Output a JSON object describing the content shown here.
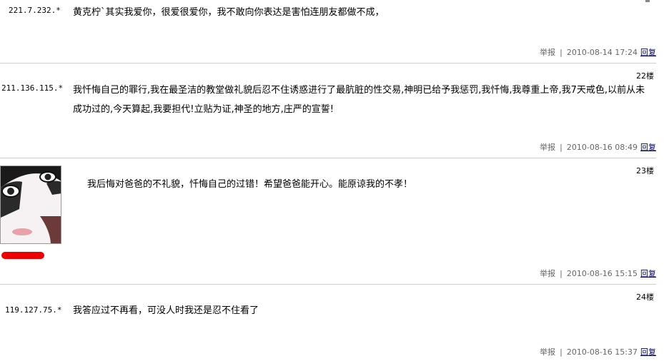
{
  "posts": [
    {
      "ip": "221.7.232.*",
      "floor": "",
      "content": "黄克柠`其实我爱你，很爱很爱你，我不敢向你表达是害怕连朋友都做不成，",
      "report": "举报",
      "date": "2010-08-14 17:24",
      "reply": "回复"
    },
    {
      "ip": "211.136.115.*",
      "floor": "22楼",
      "content": "我忏悔自己的罪行,我在最圣洁的教堂做礼貌后忍不住诱惑进行了最肮脏的性交易,神明已给予我惩罚,我忏悔,我尊重上帝,我7天戒色,以前从未成功过的,今天算起,我要担代!立贴为证,神圣的地方,庄严的宣誓!",
      "report": "举报",
      "date": "2010-08-16 08:49",
      "reply": "回复"
    },
    {
      "ip": "",
      "floor": "23楼",
      "content": "我后悔对爸爸的不礼貌，忏悔自己的过错！希望爸爸能开心。能原谅我的不孝！",
      "report": "举报",
      "date": "2010-08-16 15:15",
      "reply": "回复"
    },
    {
      "ip": "119.127.75.*",
      "floor": "24楼",
      "content": "我答应过不再看，可没人时我还是忍不住看了",
      "report": "举报",
      "date": "2010-08-16 15:37",
      "reply": "回复"
    }
  ],
  "separator": "|",
  "icons": {
    "avatar": "user-avatar-photo",
    "redacted_name": "red-redaction-mark"
  },
  "colors": {
    "redaction": "#ee0000",
    "reply_link": "#000066",
    "meta_text": "#666666",
    "separator_line": "#cfcfcf"
  }
}
